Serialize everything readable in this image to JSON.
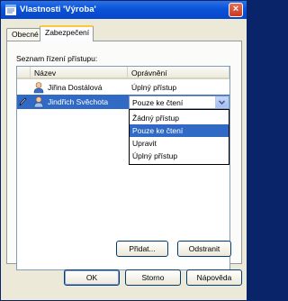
{
  "window": {
    "title": "Vlastnosti 'Výroba'",
    "close_glyph": "×"
  },
  "tabs": [
    {
      "label": "Obecné",
      "active": false
    },
    {
      "label": "Zabezpečení",
      "active": true
    }
  ],
  "acl": {
    "label": "Seznam řízení přístupu:",
    "columns": [
      "Název",
      "Oprávnění"
    ],
    "rows": [
      {
        "name": "Jiřina Dostálová",
        "permission": "Úplný přístup",
        "selected": false,
        "editing": false
      },
      {
        "name": "Jindřich Svěchota",
        "permission": "Pouze ke čtení",
        "selected": true,
        "editing": true
      }
    ],
    "dropdown_options": [
      "Žádný přístup",
      "Pouze ke čtení",
      "Upravit",
      "Úplný přístup"
    ],
    "dropdown_selected": "Pouze ke čtení"
  },
  "panel_buttons": {
    "add": "Přidat...",
    "remove": "Odstranit"
  },
  "dialog_buttons": {
    "ok": "OK",
    "cancel": "Storno",
    "help": "Nápověda"
  },
  "colors": {
    "title_bar": "#0a53d8",
    "selection": "#316ac5",
    "tab_highlight": "#ffc73c"
  }
}
